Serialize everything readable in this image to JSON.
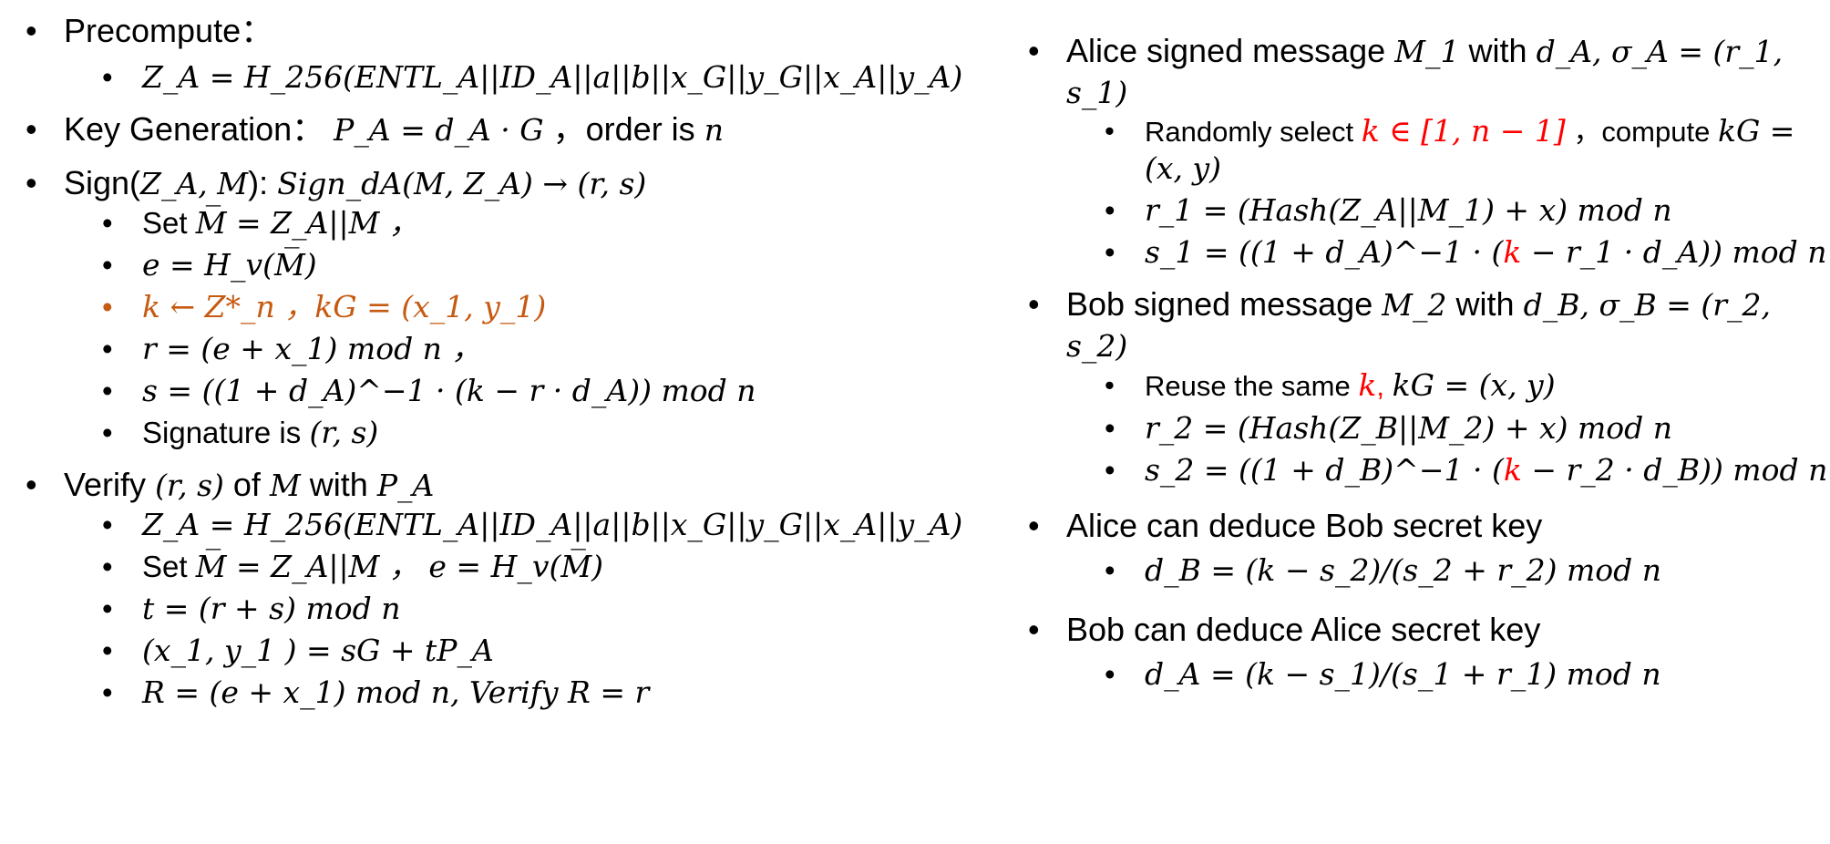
{
  "left": {
    "precompute": {
      "label": "Precompute：",
      "za_formula": "Z_A = H_256(ENTL_A||ID_A||a||b||x_G||y_G||x_A||y_A)"
    },
    "keygen": {
      "label": "Key Generation：",
      "formula": "P_A = d_A · G",
      "order_text": "，order is",
      "order_var": "n"
    },
    "sign": {
      "label": "Sign(",
      "args": "Z_A, M",
      "close": "):",
      "formula": "Sign_dA(M, Z_A) → (r, s)",
      "steps": [
        {
          "prefix": "Set",
          "formula": "M̅ = Z_A||M ，"
        },
        {
          "prefix": "",
          "formula": "e = H_v(M̅)"
        },
        {
          "prefix": "",
          "formula": "k ← Z*_n ，kG = (x_1, y_1)"
        },
        {
          "prefix": "",
          "formula": "r = (e + x_1) mod n ，"
        },
        {
          "prefix": "",
          "formula": "s = ((1 + d_A)^−1 · (k − r · d_A)) mod n"
        },
        {
          "prefix": "Signature is",
          "formula": "(r, s)"
        }
      ]
    },
    "verify": {
      "label": "Verify",
      "pair": "(r, s)",
      "of": "of",
      "m": "M",
      "with": "with",
      "pa": "P_A",
      "steps": [
        {
          "prefix": "",
          "formula": "Z_A = H_256(ENTL_A||ID_A||a||b||x_G||y_G||x_A||y_A)"
        },
        {
          "prefix": "Set",
          "formula": "M̅ = Z_A||M ，  e = H_v(M̅)"
        },
        {
          "prefix": "",
          "formula": "t = (r + s) mod n"
        },
        {
          "prefix": "",
          "formula": "(x_1, y_1 ) = sG + tP_A"
        },
        {
          "prefix": "",
          "formula": "R = (e + x_1) mod n,  Verify R = r"
        }
      ]
    }
  },
  "right": {
    "alice": {
      "label_start": "Alice signed message",
      "m": "M_1",
      "with": "with",
      "formula": "d_A, σ_A = (r_1, s_1)",
      "step1_a": "Randomly select",
      "step1_red": "k ∈ [1, n − 1]",
      "step1_b": "，compute",
      "step1_c": "kG =",
      "step1_d": "(x, y)",
      "step2": "r_1 = (Hash(Z_A||M_1) + x) mod n",
      "step3_a": "s_1 = ((1 + d_A)^−1 · (",
      "step3_k": "k",
      "step3_b": " − r_1 · d_A)) mod n"
    },
    "bob": {
      "label_start": "Bob signed message",
      "m": "M_2",
      "with": "with",
      "formula": "d_B, σ_B = (r_2, s_2)",
      "step1_a": "Reuse the same",
      "step1_k": "k",
      "step1_b": ",",
      "step1_c": "kG = (x, y)",
      "step2": "r_2 = (Hash(Z_B||M_2) + x) mod n",
      "step3_a": "s_2 = ((1 + d_B)^−1 · (",
      "step3_k": "k",
      "step3_b": " − r_2 · d_B)) mod n"
    },
    "deduce_bob": {
      "label": "Alice can deduce Bob secret key",
      "formula": "d_B = (k − s_2)/(s_2 + r_2) mod n"
    },
    "deduce_alice": {
      "label": "Bob can deduce Alice secret key",
      "formula": "d_A = (k − s_1)/(s_1 + r_1) mod n"
    }
  },
  "colors": {
    "orange": "#c55a11",
    "red": "#ff0000"
  }
}
